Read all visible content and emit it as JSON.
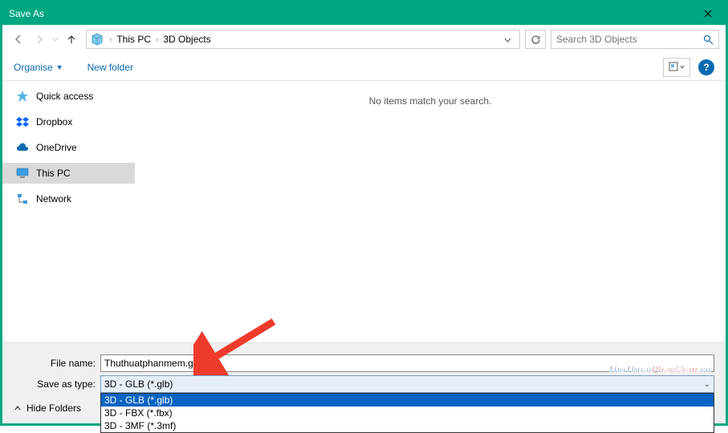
{
  "titlebar": {
    "title": "Save As"
  },
  "nav": {
    "breadcrumb": {
      "root": "This PC",
      "folder": "3D Objects"
    },
    "search_placeholder": "Search 3D Objects"
  },
  "toolbar": {
    "organise": "Organise",
    "newfolder": "New folder"
  },
  "sidebar": {
    "items": [
      {
        "label": "Quick access"
      },
      {
        "label": "Dropbox"
      },
      {
        "label": "OneDrive"
      },
      {
        "label": "This PC"
      },
      {
        "label": "Network"
      }
    ]
  },
  "content": {
    "empty_text": "No items match your search."
  },
  "form": {
    "filename_label": "File name:",
    "filename_value": "Thuthuatphanmem.glb",
    "savetype_label": "Save as type:",
    "savetype_selected": "3D - GLB (*.glb)",
    "savetype_options": [
      "3D - GLB (*.glb)",
      "3D - FBX (*.fbx)",
      "3D - 3MF (*.3mf)"
    ],
    "hide_folders": "Hide Folders"
  },
  "watermark": {
    "main": "ThuThuat",
    "accent": "PhanMem",
    "suffix": ".vn"
  }
}
